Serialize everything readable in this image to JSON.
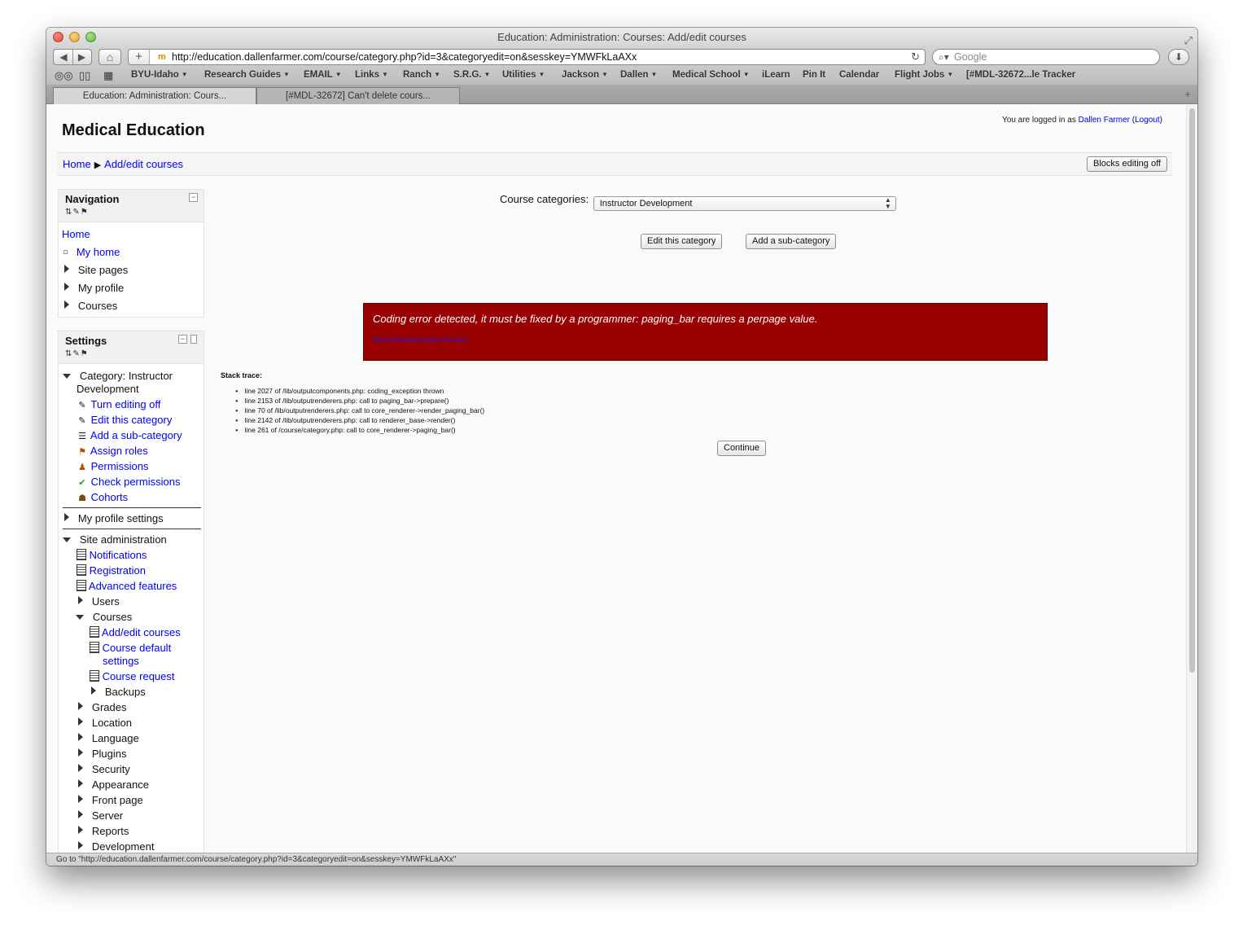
{
  "window": {
    "title": "Education: Administration: Courses: Add/edit courses"
  },
  "toolbar": {
    "url": "http://education.dallenfarmer.com/course/category.php?id=3&categoryedit=on&sesskey=YMWFkLaAXx",
    "search_placeholder": "Google"
  },
  "bookmarks": [
    {
      "label": "BYU-Idaho",
      "menu": true
    },
    {
      "label": "Research Guides",
      "menu": true
    },
    {
      "label": "EMAIL",
      "menu": true
    },
    {
      "label": "Links",
      "menu": true
    },
    {
      "label": "Ranch",
      "menu": true
    },
    {
      "label": "S.R.G.",
      "menu": true
    },
    {
      "label": "Utilities",
      "menu": true
    },
    {
      "label": "Jackson",
      "menu": true
    },
    {
      "label": "Dallen",
      "menu": true
    },
    {
      "label": "Medical School",
      "menu": true
    },
    {
      "label": "iLearn",
      "menu": false
    },
    {
      "label": "Pin It",
      "menu": false
    },
    {
      "label": "Calendar",
      "menu": false
    },
    {
      "label": "Flight Jobs",
      "menu": true
    },
    {
      "label": "[#MDL-32672...le Tracker",
      "menu": false
    }
  ],
  "tabs": [
    {
      "label": "Education: Administration: Cours..."
    },
    {
      "label": "[#MDL-32672] Can't delete cours..."
    }
  ],
  "page": {
    "site_title": "Medical Education",
    "login_prefix": "You are logged in as ",
    "login_user": "Dallen Farmer",
    "logout": "(Logout)",
    "breadcrumb": [
      "Home",
      "Add/edit courses"
    ],
    "blocks_editing_button": "Blocks editing off"
  },
  "navigation": {
    "title": "Navigation",
    "items": [
      "Home",
      "My home",
      "Site pages",
      "My profile",
      "Courses"
    ]
  },
  "settings": {
    "title": "Settings",
    "category_label": "Category: Instructor",
    "category_label_2": "Development",
    "category_items": [
      "Turn editing off",
      "Edit this category",
      "Add a sub-category",
      "Assign roles",
      "Permissions",
      "Check permissions",
      "Cohorts"
    ],
    "my_profile_settings": "My profile settings",
    "site_admin": "Site administration",
    "site_admin_items": [
      "Notifications",
      "Registration",
      "Advanced features",
      "Users",
      "Courses"
    ],
    "courses_items": [
      "Add/edit courses",
      "Course default",
      "settings",
      "Course request",
      "Backups"
    ],
    "more_items": [
      "Grades",
      "Location",
      "Language",
      "Plugins",
      "Security",
      "Appearance",
      "Front page",
      "Server",
      "Reports",
      "Development"
    ]
  },
  "main": {
    "course_categories_label": "Course categories:",
    "course_categories_value": "Instructor Development",
    "edit_category_button": "Edit this category",
    "add_subcategory_button": "Add a sub-category",
    "error_message": "Coding error detected, it must be fixed by a programmer: paging_bar requires a perpage value.",
    "error_link": "More information about this error",
    "stack_trace_title": "Stack trace:",
    "stack_trace": [
      "line 2027 of /lib/outputcomponents.php: coding_exception thrown",
      "line 2153 of /lib/outputrenderers.php: call to paging_bar->prepare()",
      "line 70 of /lib/outputrenderers.php: call to core_renderer->render_paging_bar()",
      "line 2142 of /lib/outputrenderers.php: call to renderer_base->render()",
      "line 261 of /course/category.php: call to core_renderer->paging_bar()"
    ],
    "continue_button": "Continue"
  },
  "status_bar": "Go to \"http://education.dallenfarmer.com/course/category.php?id=3&categoryedit=on&sesskey=YMWFkLaAXx\""
}
